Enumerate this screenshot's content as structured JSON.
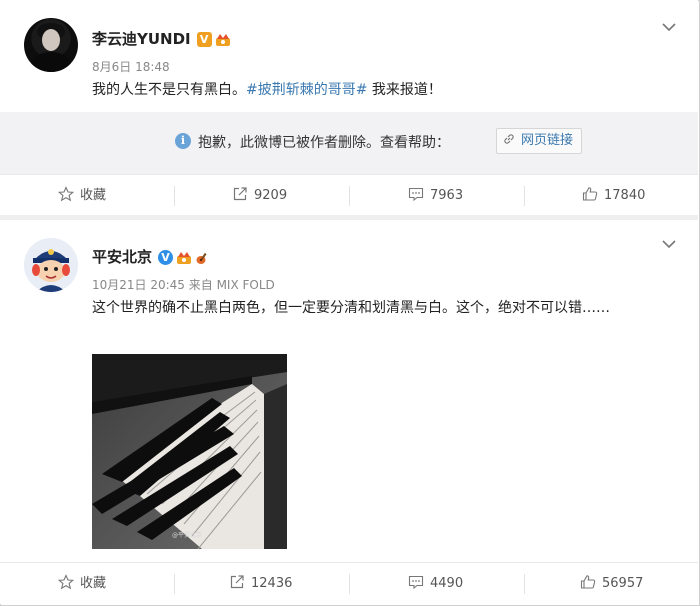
{
  "posts": [
    {
      "author": "李云迪YUNDI",
      "badge": "V",
      "time": "8月6日 18:48",
      "text_before": "我的人生不是只有黑白。",
      "hashtag": "#披荆斩棘的哥哥#",
      "text_after": " 我来报道！",
      "deleted_notice": "抱歉，此微博已被作者删除。查看帮助：",
      "help_link": "网页链接",
      "actions": {
        "favorite": "收藏",
        "reposts": "9209",
        "comments": "7963",
        "likes": "17840"
      }
    },
    {
      "author": "平安北京",
      "badge": "V",
      "time": "10月21日 20:45 来自 MIX FOLD",
      "text": "这个世界的确不止黑白两色，但一定要分清和划清黑与白。这个，绝对不可以错……",
      "photo_watermark": "@平安北京",
      "actions": {
        "favorite": "收藏",
        "reposts": "12436",
        "comments": "4490",
        "likes": "56957"
      }
    }
  ],
  "colors": {
    "hashtag": "#3a79b0",
    "verified_orange": "#f0a020",
    "verified_blue": "#2f8ee6"
  },
  "icons": [
    "star-icon",
    "share-icon",
    "comment-icon",
    "like-icon",
    "chevron-down-icon",
    "info-icon",
    "link-icon",
    "crown-icon",
    "guitar-icon"
  ]
}
